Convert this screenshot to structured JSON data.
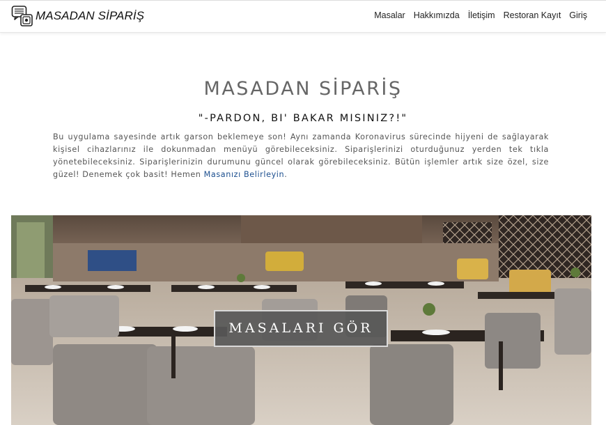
{
  "brand": {
    "name": "MASADAN SİPARİŞ",
    "icon": "menu-chat-icon"
  },
  "nav": {
    "items": [
      {
        "label": "Masalar"
      },
      {
        "label": "Hakkımızda"
      },
      {
        "label": "İletişim"
      },
      {
        "label": "Restoran Kayıt"
      },
      {
        "label": "Giriş"
      }
    ]
  },
  "hero": {
    "title": "MASADAN SİPARİŞ",
    "subtitle": "\"-PARDON, BI' BAKAR MISINIZ?!\"",
    "description": "Bu uygulama sayesinde artık garson beklemeye son! Aynı zamanda Koronavirus sürecinde hijyeni de sağlayarak kişisel cihazlarınız ile dokunmadan menüyü görebileceksiniz. Siparişlerinizi oturduğunuz yerden tek tıkla yönetebileceksiniz. Siparişlerinizin durumunu güncel olarak görebileceksiniz. Bütün işlemler artık size özel, size güzel! Denemek çok basit! Hemen ",
    "link_label": "Masanızı Belirleyin",
    "after_link": "."
  },
  "cta": {
    "label": "MASALARI GÖR"
  },
  "colors": {
    "link": "#1c4f8f",
    "title": "#666666",
    "button_bg": "#585858"
  }
}
